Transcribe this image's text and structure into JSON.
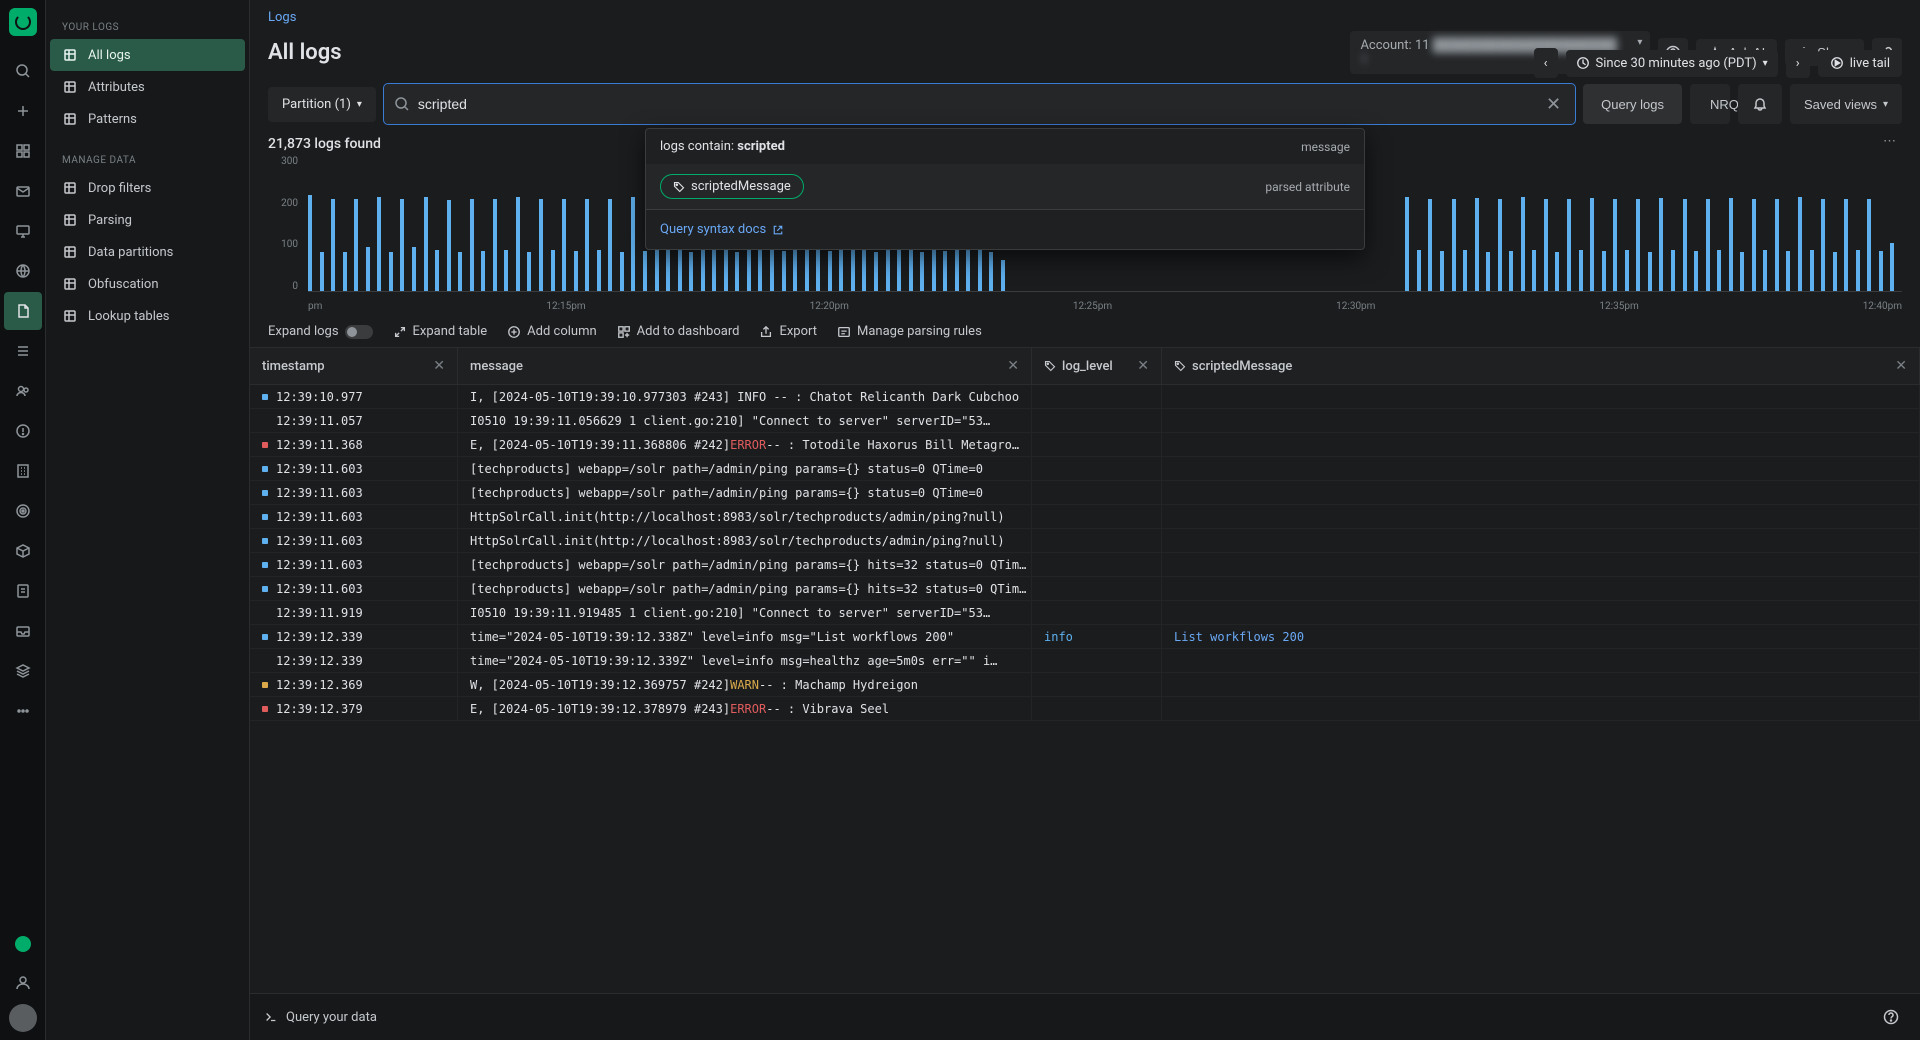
{
  "rail": {
    "icons": [
      "search",
      "plus",
      "grid",
      "mail",
      "monitor",
      "globe",
      "file",
      "list",
      "users",
      "alert",
      "building",
      "target",
      "box",
      "paper",
      "inbox",
      "stack",
      "more"
    ]
  },
  "sidebar": {
    "section1": "YOUR LOGS",
    "items1": [
      {
        "icon": "logs",
        "label": "All logs",
        "active": true
      },
      {
        "icon": "attr",
        "label": "Attributes"
      },
      {
        "icon": "pattern",
        "label": "Patterns"
      }
    ],
    "section2": "MANAGE DATA",
    "items2": [
      {
        "icon": "filter",
        "label": "Drop filters"
      },
      {
        "icon": "parse",
        "label": "Parsing"
      },
      {
        "icon": "partition",
        "label": "Data partitions"
      },
      {
        "icon": "obfus",
        "label": "Obfuscation"
      },
      {
        "icon": "lookup",
        "label": "Lookup tables"
      }
    ]
  },
  "breadcrumb": "Logs",
  "page_title": "All logs",
  "account": {
    "label": "Account:",
    "value": "11",
    "blurred": "████████████████████ 1"
  },
  "topbuttons": {
    "ask_ai": "Ask AI",
    "share": "Share"
  },
  "time": {
    "since": "Since 30 minutes ago (PDT)",
    "live_tail": "live tail"
  },
  "partition": "Partition (1)",
  "search": {
    "value": "scripted"
  },
  "toolbar": {
    "query_logs": "Query logs",
    "nrql": "NRQL",
    "saved_views": "Saved views"
  },
  "autocomplete": {
    "row1_left": "logs contain:",
    "row1_term": "scripted",
    "row1_right": "message",
    "row2_pill": "scriptedMessage",
    "row2_right": "parsed attribute",
    "footer": "Query syntax docs"
  },
  "count": "21,873 logs found",
  "chart_data": {
    "type": "bar",
    "ylabel": "",
    "xlabel": "",
    "ylim": [
      0,
      300
    ],
    "y_ticks": [
      "300",
      "200",
      "100",
      "0"
    ],
    "x_ticks": [
      "pm",
      "12:15pm",
      "12:20pm",
      "12:25pm",
      "12:30pm",
      "12:35pm",
      "12:40pm"
    ],
    "values": [
      220,
      90,
      210,
      90,
      210,
      100,
      215,
      90,
      210,
      100,
      215,
      95,
      208,
      90,
      210,
      92,
      210,
      95,
      215,
      90,
      210,
      95,
      210,
      92,
      210,
      95,
      210,
      90,
      215,
      92,
      210,
      95,
      210,
      90,
      212,
      95,
      208,
      90,
      210,
      95,
      210,
      92,
      210,
      95,
      210,
      92,
      215,
      95,
      210,
      90,
      212,
      95,
      210,
      90,
      215,
      92,
      210,
      95,
      210,
      90,
      70,
      0,
      0,
      0,
      0,
      0,
      0,
      0,
      0,
      0,
      0,
      0,
      0,
      0,
      0,
      0,
      0,
      0,
      0,
      0,
      0,
      0,
      0,
      0,
      0,
      0,
      0,
      0,
      0,
      0,
      0,
      0,
      0,
      0,
      0,
      215,
      95,
      210,
      92,
      210,
      95,
      212,
      90,
      210,
      92,
      215,
      95,
      210,
      90,
      210,
      95,
      212,
      92,
      210,
      95,
      210,
      90,
      212,
      95,
      210,
      92,
      210,
      95,
      212,
      90,
      210,
      95,
      210,
      92,
      215,
      95,
      210,
      90,
      210,
      95,
      210,
      92,
      110
    ]
  },
  "actions": {
    "expand_logs": "Expand logs",
    "expand_table": "Expand table",
    "add_column": "Add column",
    "add_dashboard": "Add to dashboard",
    "export": "Export",
    "manage_rules": "Manage parsing rules"
  },
  "columns": {
    "timestamp": "timestamp",
    "message": "message",
    "log_level": "log_level",
    "scriptedMessage": "scriptedMessage"
  },
  "rows": [
    {
      "sev": "info",
      "ts": "12:39:10.977",
      "msg": "I, [2024-05-10T19:39:10.977303 #243]  INFO -- : Chatot Relicanth Dark Cubchoo",
      "lvl": "",
      "scr": ""
    },
    {
      "sev": "none",
      "ts": "12:39:11.057",
      "msg": "I0510 19:39:11.056629       1 client.go:210] \"Connect to server\" serverID=\"53…",
      "lvl": "",
      "scr": ""
    },
    {
      "sev": "error",
      "ts": "12:39:11.368",
      "msg": "E, [2024-05-10T19:39:11.368806 #242] ERROR -- : Totodile Haxorus Bill Metagro…",
      "lvl": "",
      "scr": "",
      "cls": "msg-error"
    },
    {
      "sev": "info",
      "ts": "12:39:11.603",
      "msg": "[techproducts]  webapp=/solr path=/admin/ping params={} status=0 QTime=0",
      "lvl": "",
      "scr": ""
    },
    {
      "sev": "info",
      "ts": "12:39:11.603",
      "msg": "[techproducts]  webapp=/solr path=/admin/ping params={} status=0 QTime=0",
      "lvl": "",
      "scr": ""
    },
    {
      "sev": "info",
      "ts": "12:39:11.603",
      "msg": "HttpSolrCall.init(http://localhost:8983/solr/techproducts/admin/ping?null)",
      "lvl": "",
      "scr": ""
    },
    {
      "sev": "info",
      "ts": "12:39:11.603",
      "msg": "HttpSolrCall.init(http://localhost:8983/solr/techproducts/admin/ping?null)",
      "lvl": "",
      "scr": ""
    },
    {
      "sev": "info",
      "ts": "12:39:11.603",
      "msg": "[techproducts]  webapp=/solr path=/admin/ping params={} hits=32 status=0 QTim…",
      "lvl": "",
      "scr": ""
    },
    {
      "sev": "info",
      "ts": "12:39:11.603",
      "msg": "[techproducts]  webapp=/solr path=/admin/ping params={} hits=32 status=0 QTim…",
      "lvl": "",
      "scr": ""
    },
    {
      "sev": "none",
      "ts": "12:39:11.919",
      "msg": "I0510 19:39:11.919485       1 client.go:210] \"Connect to server\" serverID=\"53…",
      "lvl": "",
      "scr": ""
    },
    {
      "sev": "info",
      "ts": "12:39:12.339",
      "msg": "time=\"2024-05-10T19:39:12.338Z\" level=info msg=\"List workflows 200\"",
      "lvl": "info",
      "scr": "List workflows 200"
    },
    {
      "sev": "none",
      "ts": "12:39:12.339",
      "msg": "time=\"2024-05-10T19:39:12.339Z\" level=info msg=healthz age=5m0s err=\"<nil>\" i…",
      "lvl": "",
      "scr": ""
    },
    {
      "sev": "warn",
      "ts": "12:39:12.369",
      "msg": "W, [2024-05-10T19:39:12.369757 #242]  WARN -- : Machamp Hydreigon",
      "lvl": "",
      "scr": "",
      "cls": "msg-warn"
    },
    {
      "sev": "error",
      "ts": "12:39:12.379",
      "msg": "E, [2024-05-10T19:39:12.378979 #243] ERROR -- : Vibrava Seel",
      "lvl": "",
      "scr": "",
      "cls": "msg-error"
    }
  ],
  "footer": {
    "query": "Query your data"
  }
}
